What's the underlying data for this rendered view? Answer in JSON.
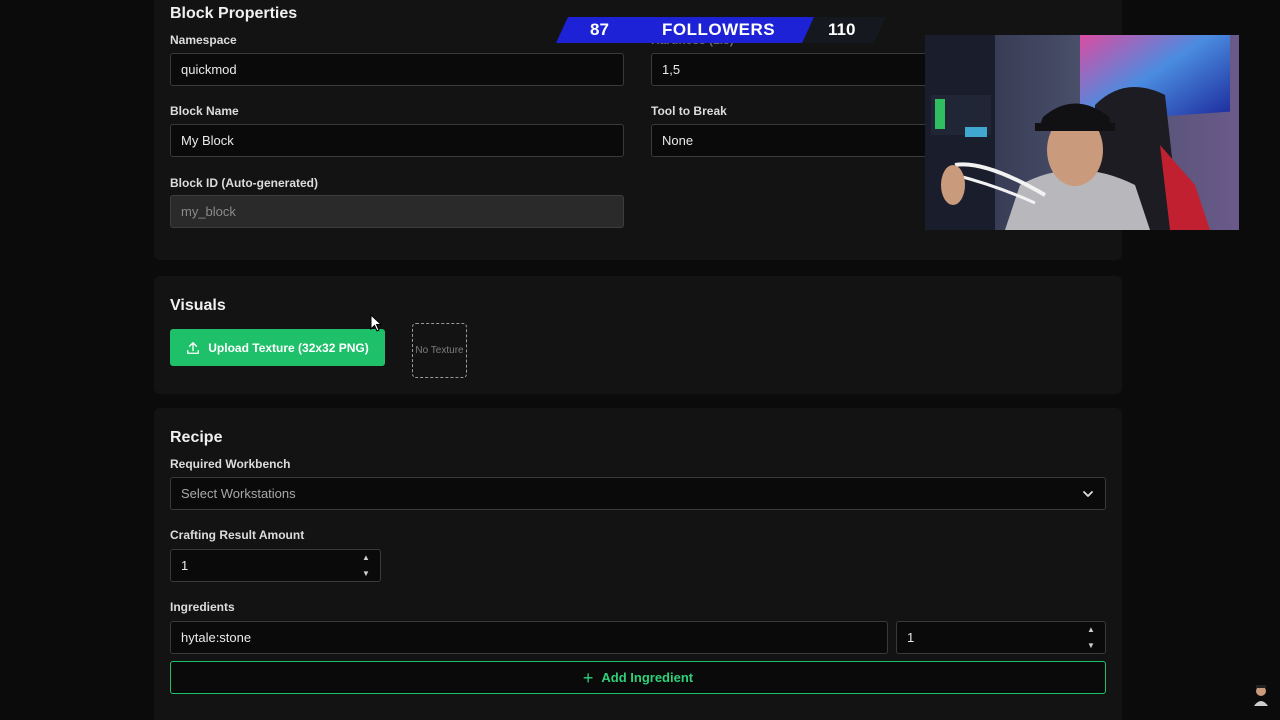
{
  "block_properties": {
    "heading": "Block Properties",
    "namespace_label": "Namespace",
    "namespace_value": "quickmod",
    "hardness_label": "Hardness (1.5)",
    "hardness_value": "1,5",
    "block_name_label": "Block Name",
    "block_name_value": "My Block",
    "tool_label": "Tool to Break",
    "tool_value": "None",
    "block_id_label": "Block ID (Auto-generated)",
    "block_id_value": "my_block"
  },
  "visuals": {
    "heading": "Visuals",
    "upload_label": "Upload Texture (32x32 PNG)",
    "preview_text": "No Texture"
  },
  "recipe": {
    "heading": "Recipe",
    "workbench_label": "Required Workbench",
    "workbench_placeholder": "Select Workstations",
    "amount_label": "Crafting Result Amount",
    "amount_value": "1",
    "ingredients_label": "Ingredients",
    "ingredients": [
      {
        "item": "hytale:stone",
        "qty": "1"
      }
    ],
    "add_ingredient_label": "Add Ingredient"
  },
  "overlay": {
    "followers_current": "87",
    "followers_label": "FOLLOWERS",
    "followers_goal": "110",
    "bar_color": "#1d22d6"
  },
  "colors": {
    "accent_green": "#1fc06a",
    "background": "#0b0b0b",
    "panel": "#131313"
  }
}
